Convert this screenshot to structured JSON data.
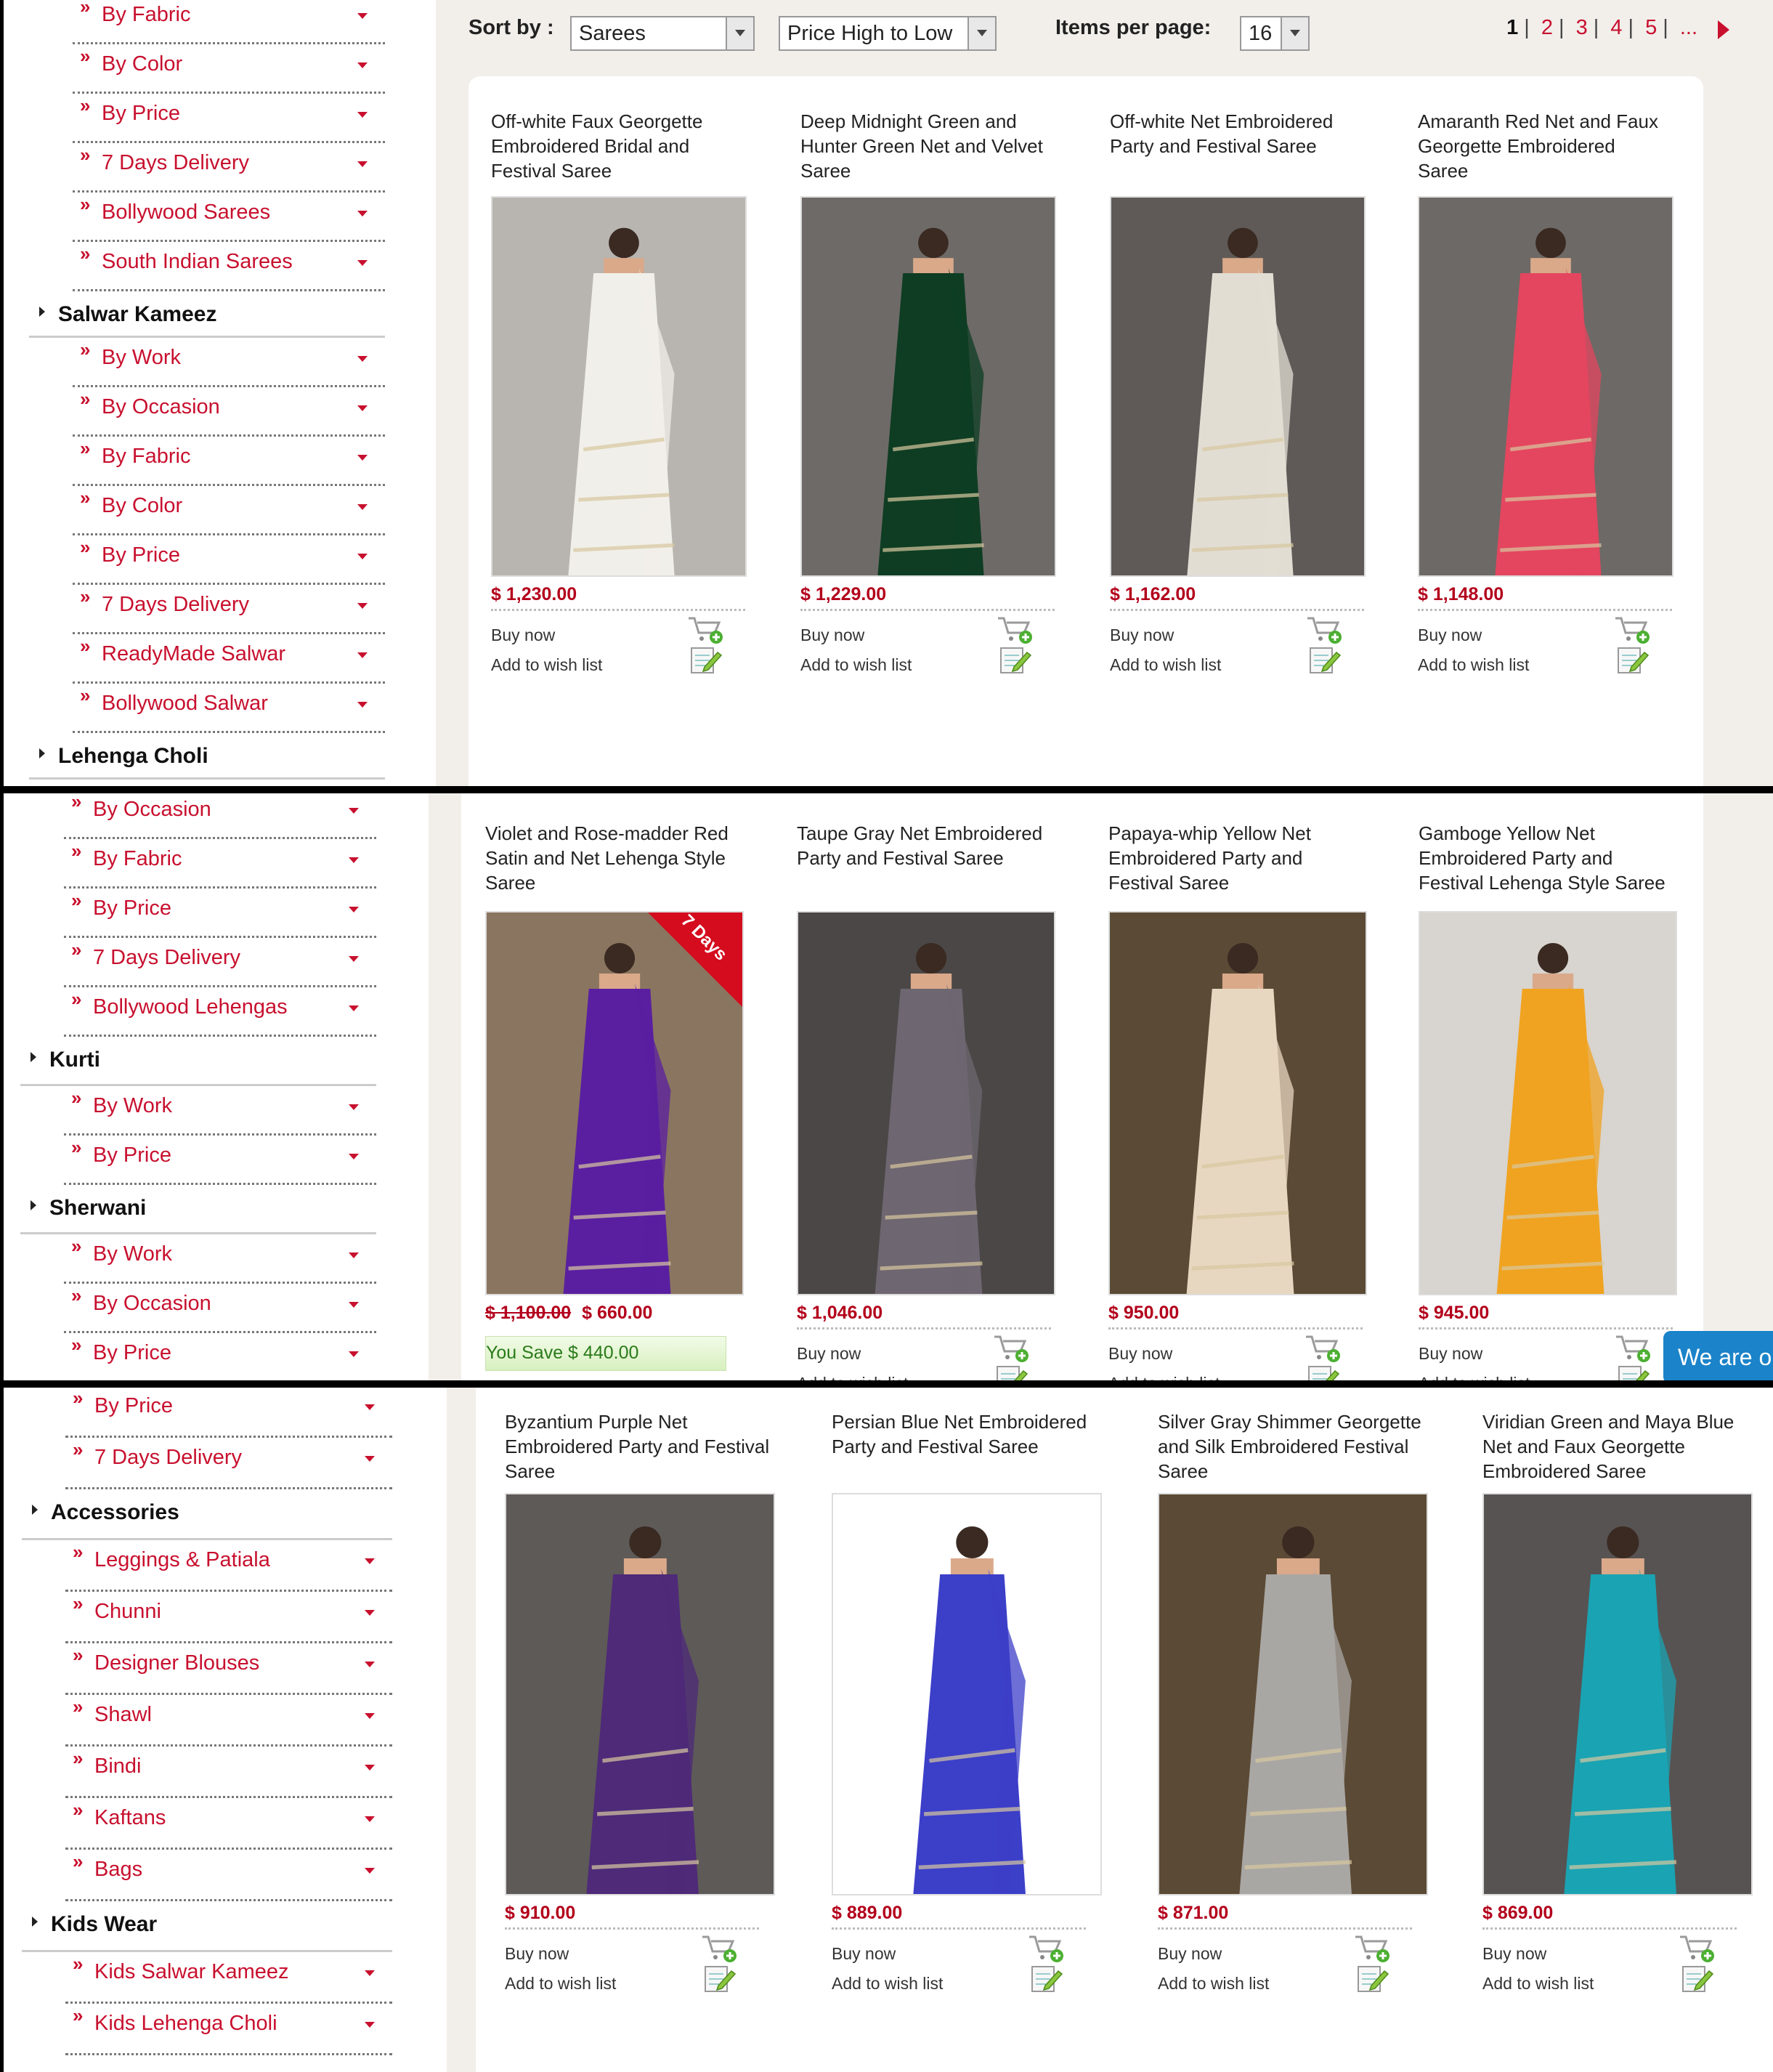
{
  "toolbar": {
    "sort_label": "Sort by :",
    "sort_category": "Sarees",
    "sort_order": "Price High to Low",
    "items_label": "Items per page:",
    "items_value": "16",
    "pages": [
      "1",
      "2",
      "3",
      "4",
      "5",
      "..."
    ]
  },
  "sidebar1": [
    {
      "type": "sub",
      "label": "By Fabric"
    },
    {
      "type": "sub",
      "label": "By Color"
    },
    {
      "type": "sub",
      "label": "By Price"
    },
    {
      "type": "sub",
      "label": "7 Days Delivery"
    },
    {
      "type": "sub",
      "label": "Bollywood Sarees"
    },
    {
      "type": "sub",
      "label": "South Indian Sarees"
    },
    {
      "type": "cat",
      "label": "Salwar Kameez"
    },
    {
      "type": "sub",
      "label": "By Work"
    },
    {
      "type": "sub",
      "label": "By Occasion"
    },
    {
      "type": "sub",
      "label": "By Fabric"
    },
    {
      "type": "sub",
      "label": "By Color"
    },
    {
      "type": "sub",
      "label": "By Price"
    },
    {
      "type": "sub",
      "label": "7 Days Delivery"
    },
    {
      "type": "sub",
      "label": "ReadyMade Salwar"
    },
    {
      "type": "sub",
      "label": "Bollywood Salwar"
    },
    {
      "type": "cat",
      "label": "Lehenga Choli"
    }
  ],
  "sidebar2": [
    {
      "type": "sub",
      "label": "By Occasion"
    },
    {
      "type": "sub",
      "label": "By Fabric"
    },
    {
      "type": "sub",
      "label": "By Price"
    },
    {
      "type": "sub",
      "label": "7 Days Delivery"
    },
    {
      "type": "sub",
      "label": "Bollywood Lehengas"
    },
    {
      "type": "cat",
      "label": "Kurti"
    },
    {
      "type": "sub",
      "label": "By Work"
    },
    {
      "type": "sub",
      "label": "By Price"
    },
    {
      "type": "cat",
      "label": "Sherwani"
    },
    {
      "type": "sub",
      "label": "By Work"
    },
    {
      "type": "sub",
      "label": "By Occasion"
    },
    {
      "type": "sub",
      "label": "By Price"
    }
  ],
  "sidebar3": [
    {
      "type": "sub",
      "label": "By Price"
    },
    {
      "type": "sub",
      "label": "7 Days Delivery"
    },
    {
      "type": "cat",
      "label": "Accessories"
    },
    {
      "type": "sub",
      "label": "Leggings & Patiala"
    },
    {
      "type": "sub",
      "label": "Chunni"
    },
    {
      "type": "sub",
      "label": "Designer Blouses"
    },
    {
      "type": "sub",
      "label": "Shawl"
    },
    {
      "type": "sub",
      "label": "Bindi"
    },
    {
      "type": "sub",
      "label": "Kaftans"
    },
    {
      "type": "sub",
      "label": "Bags"
    },
    {
      "type": "cat",
      "label": "Kids Wear"
    },
    {
      "type": "sub",
      "label": "Kids Salwar Kameez"
    },
    {
      "type": "sub",
      "label": "Kids Lehenga Choli"
    }
  ],
  "labels": {
    "buy_now": "Buy now",
    "wish": "Add to wish list"
  },
  "row1": [
    {
      "title": "Off-white Faux Georgette Embroidered Bridal and Festival Saree",
      "price": "$ 1,230.00",
      "color": "#f1efe9",
      "bg": "#b8b5b1"
    },
    {
      "title": "Deep Midnight Green and Hunter Green Net and Velvet Saree",
      "price": "$ 1,229.00",
      "color": "#0e3d23",
      "bg": "#6e6a67"
    },
    {
      "title": "Off-white Net Embroidered Party and Festival Saree",
      "price": "$ 1,162.00",
      "color": "#e2ddd3",
      "bg": "#5f5a57"
    },
    {
      "title": "Amaranth Red Net and Faux Georgette Embroidered Saree",
      "price": "$ 1,148.00",
      "color": "#e4465f",
      "bg": "#6d6966"
    }
  ],
  "row2": [
    {
      "title": "Violet and Rose-madder Red Satin and Net Lehenga Style Saree",
      "old_price": "$ 1,100.00",
      "price": "$ 660.00",
      "save": "You Save $ 440.00",
      "badge": "7 Days",
      "color": "#5a1fa0",
      "bg": "#8a7560"
    },
    {
      "title": "Taupe Gray Net Embroidered Party and Festival Saree",
      "price": "$ 1,046.00",
      "color": "#6e6670",
      "bg": "#4a4746"
    },
    {
      "title": "Papaya-whip Yellow Net Embroidered Party and Festival Saree",
      "price": "$ 950.00",
      "color": "#e8d7c0",
      "bg": "#5b4a35"
    },
    {
      "title": "Gamboge Yellow Net Embroidered Party and Festival Lehenga Style Saree",
      "price": "$ 945.00",
      "color": "#f0a320",
      "bg": "#d8d4cf"
    }
  ],
  "row3": [
    {
      "title": "Byzantium Purple Net Embroidered Party and Festival Saree",
      "price": "$ 910.00",
      "color": "#4e2a78",
      "bg": "#5e5a58"
    },
    {
      "title": "Persian Blue Net Embroidered Party and Festival Saree",
      "price": "$ 889.00",
      "color": "#3c3fc8",
      "bg": "#ffffff"
    },
    {
      "title": "Silver Gray Shimmer Georgette and Silk Embroidered Festival Saree",
      "price": "$ 871.00",
      "color": "#a9a7a4",
      "bg": "#5b4a35"
    },
    {
      "title": "Viridian Green and Maya Blue Net and Faux Georgette Embroidered Saree",
      "price": "$ 869.00",
      "color": "#1aa3b3",
      "bg": "#575352"
    }
  ],
  "chat_text": "We are o",
  "colors": {
    "accent": "#c8102e",
    "price": "#b3001b",
    "panel_bg": "#f2efeb"
  }
}
